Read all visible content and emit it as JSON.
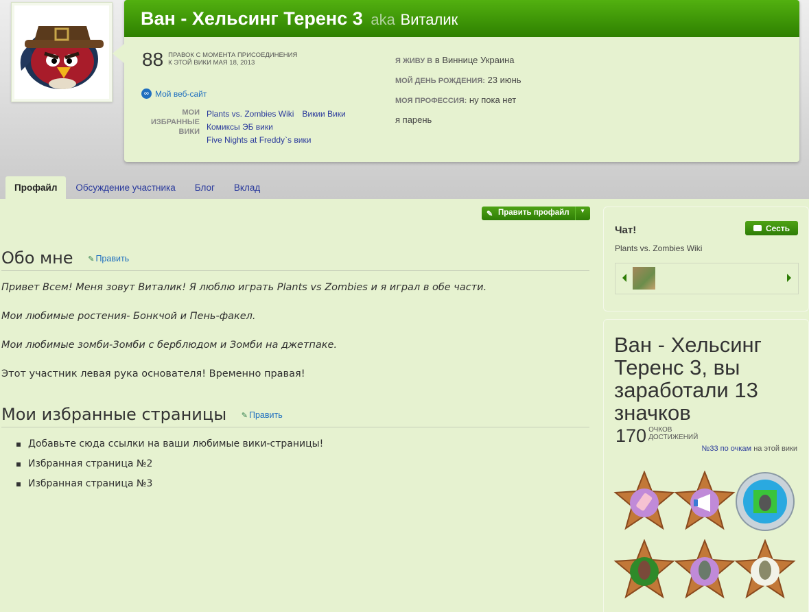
{
  "profile": {
    "name": "Ван - Хельсинг Теренс 3",
    "aka_label": "aka",
    "nickname": "Виталик",
    "edit_count": "88",
    "edit_label_line1": "правок с момента присоединения",
    "edit_label_line2": "к этой вики мая 18, 2013",
    "website_label": "Мой веб-сайт",
    "fav_wikis_label_1": "МОИ",
    "fav_wikis_label_2": "ИЗБРАННЫЕ",
    "fav_wikis_label_3": "ВИКИ",
    "fav_wikis": [
      "Plants vs. Zombies Wiki",
      "Викии Вики",
      "Комиксы ЭБ вики",
      "Five Nights at Freddy`s вики"
    ],
    "live_label": "Я живу в",
    "live_value": "в Виннице Украина",
    "birthday_label": "Мой день рождения:",
    "birthday_value": "23 июнь",
    "job_label": "Моя профессия:",
    "job_value": "ну пока нет",
    "gender_value": "я парень"
  },
  "tabs": [
    "Профайл",
    "Обсуждение участника",
    "Блог",
    "Вклад"
  ],
  "edit_profile_button": "Править профайл",
  "about": {
    "heading": "Обо мне",
    "edit_label": "Править",
    "paragraphs": [
      "Привет Всем! Меня зовут Виталик! Я люблю играть Plants vs Zombies и я играл в обе части.",
      "Мои любимые ростения- Бонкчой и Пень-факел.",
      "Мои любимые зомби-Зомби с берблюдом и Зомби на джетпаке.",
      "Этот участник левая рука основателя! Временно правая!"
    ]
  },
  "favorites": {
    "heading": "Мои избранные страницы",
    "edit_label": "Править",
    "items": [
      "Добавьте сюда ссылки на ваши любимые вики-страницы!",
      "Избранная страница №2",
      "Избранная страница №3"
    ]
  },
  "chat": {
    "title": "Чат!",
    "join_label": "Сесть",
    "wiki_name": "Plants vs. Zombies Wiki"
  },
  "achievements": {
    "title": "Ван - Хельсинг Теренс 3, вы заработали 13 значков",
    "points": "170",
    "points_label_1": "очков",
    "points_label_2": "достижений",
    "rank_link": "№33 по очкам",
    "rank_suffix": "на этой вики"
  },
  "colors": {
    "background": "#e6f2d0",
    "title_bar": "#3f9a0a",
    "link": "#1f6fbf",
    "button_green": "#2e7d06"
  }
}
